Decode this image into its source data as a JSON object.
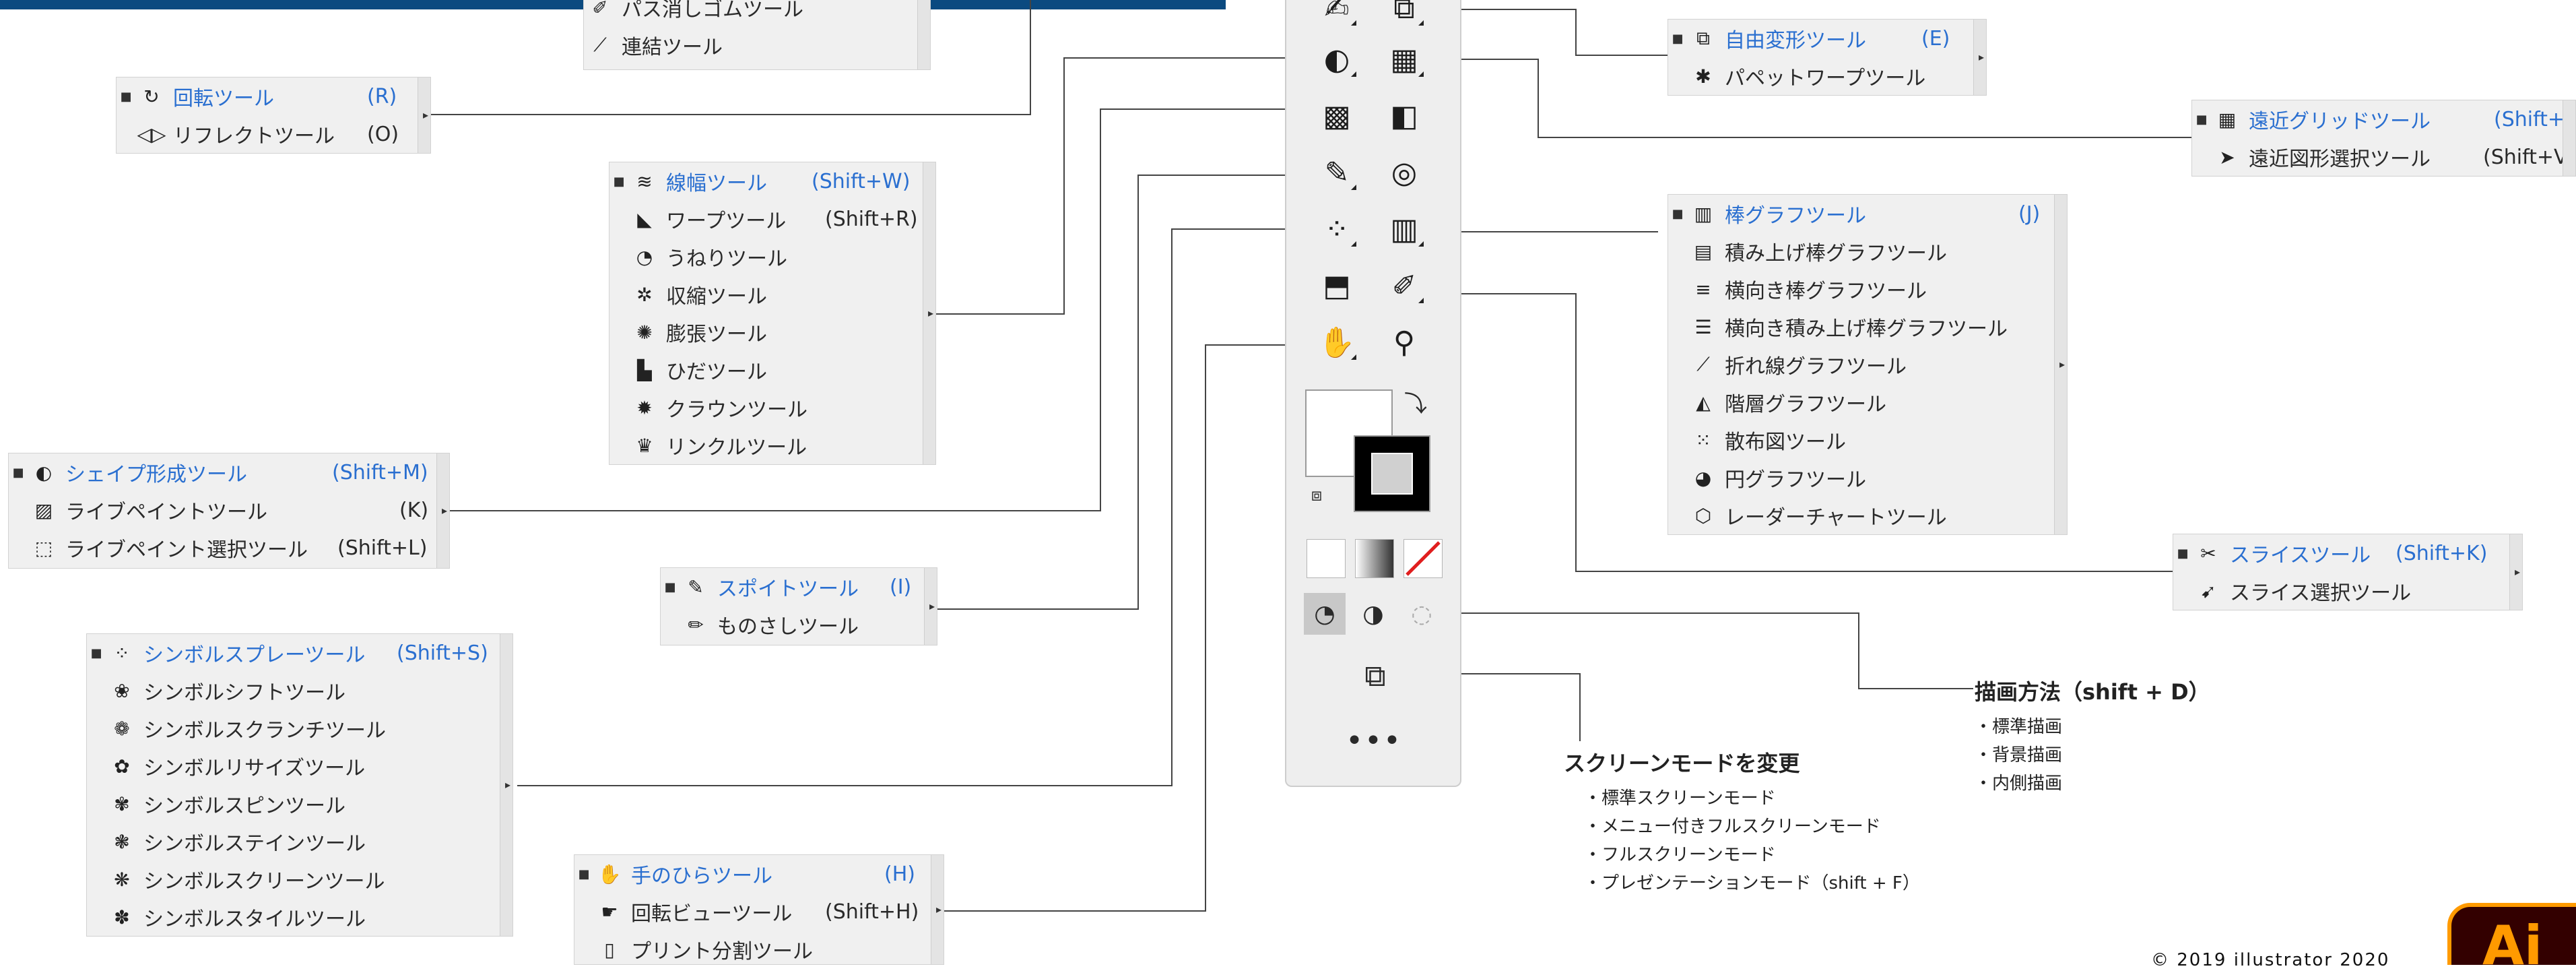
{
  "accent_color": "#2a6fd0",
  "panels": {
    "eraser": {
      "tools": [
        {
          "icon": "path-eraser-icon",
          "name": "パス消しゴムツール",
          "key": ""
        },
        {
          "icon": "join-icon",
          "name": "連結ツール",
          "key": ""
        }
      ]
    },
    "rotate": {
      "tools": [
        {
          "icon": "rotate-icon",
          "name": "回転ツール",
          "key": "(R)"
        },
        {
          "icon": "reflect-icon",
          "name": "リフレクトツール",
          "key": "(O)"
        }
      ]
    },
    "width": {
      "tools": [
        {
          "icon": "width-icon",
          "name": "線幅ツール",
          "key": "(Shift+W)"
        },
        {
          "icon": "warp-icon",
          "name": "ワープツール",
          "key": "(Shift+R)"
        },
        {
          "icon": "twirl-icon",
          "name": "うねりツール",
          "key": ""
        },
        {
          "icon": "pucker-icon",
          "name": "収縮ツール",
          "key": ""
        },
        {
          "icon": "bloat-icon",
          "name": "膨張ツール",
          "key": ""
        },
        {
          "icon": "scallop-icon",
          "name": "ひだツール",
          "key": ""
        },
        {
          "icon": "crystallize-icon",
          "name": "クラウンツール",
          "key": ""
        },
        {
          "icon": "wrinkle-icon",
          "name": "リンクルツール",
          "key": ""
        }
      ]
    },
    "shape_builder": {
      "tools": [
        {
          "icon": "shape-builder-icon",
          "name": "シェイプ形成ツール",
          "key": "(Shift+M)"
        },
        {
          "icon": "live-paint-icon",
          "name": "ライブペイントツール",
          "key": "(K)"
        },
        {
          "icon": "live-paint-select-icon",
          "name": "ライブペイント選択ツール",
          "key": "(Shift+L)"
        }
      ]
    },
    "eyedropper": {
      "tools": [
        {
          "icon": "eyedropper-icon",
          "name": "スポイトツール",
          "key": "(I)"
        },
        {
          "icon": "measure-icon",
          "name": "ものさしツール",
          "key": ""
        }
      ]
    },
    "symbol": {
      "tools": [
        {
          "icon": "symbol-sprayer-icon",
          "name": "シンボルスプレーツール",
          "key": "(Shift+S)"
        },
        {
          "icon": "symbol-shifter-icon",
          "name": "シンボルシフトツール",
          "key": ""
        },
        {
          "icon": "symbol-scruncher-icon",
          "name": "シンボルスクランチツール",
          "key": ""
        },
        {
          "icon": "symbol-sizer-icon",
          "name": "シンボルリサイズツール",
          "key": ""
        },
        {
          "icon": "symbol-spinner-icon",
          "name": "シンボルスピンツール",
          "key": ""
        },
        {
          "icon": "symbol-stainer-icon",
          "name": "シンボルステインツール",
          "key": ""
        },
        {
          "icon": "symbol-screener-icon",
          "name": "シンボルスクリーンツール",
          "key": ""
        },
        {
          "icon": "symbol-styler-icon",
          "name": "シンボルスタイルツール",
          "key": ""
        }
      ]
    },
    "hand": {
      "tools": [
        {
          "icon": "hand-icon",
          "name": "手のひらツール",
          "key": "(H)"
        },
        {
          "icon": "rotate-view-icon",
          "name": "回転ビューツール",
          "key": "(Shift+H)"
        },
        {
          "icon": "print-tiling-icon",
          "name": "プリント分割ツール",
          "key": ""
        }
      ]
    },
    "free_transform": {
      "tools": [
        {
          "icon": "free-transform-icon",
          "name": "自由変形ツール",
          "key": "(E)"
        },
        {
          "icon": "puppet-warp-icon",
          "name": "パペットワープツール",
          "key": ""
        }
      ]
    },
    "perspective": {
      "tools": [
        {
          "icon": "perspective-grid-icon",
          "name": "遠近グリッドツール",
          "key": "(Shift+P)"
        },
        {
          "icon": "perspective-select-icon",
          "name": "遠近図形選択ツール",
          "key": "(Shift+V)"
        }
      ]
    },
    "graph": {
      "tools": [
        {
          "icon": "column-graph-icon",
          "name": "棒グラフツール",
          "key": "(J)"
        },
        {
          "icon": "stacked-column-icon",
          "name": "積み上げ棒グラフツール",
          "key": ""
        },
        {
          "icon": "bar-graph-icon",
          "name": "横向き棒グラフツール",
          "key": ""
        },
        {
          "icon": "stacked-bar-icon",
          "name": "横向き積み上げ棒グラフツール",
          "key": ""
        },
        {
          "icon": "line-graph-icon",
          "name": "折れ線グラフツール",
          "key": ""
        },
        {
          "icon": "area-graph-icon",
          "name": "階層グラフツール",
          "key": ""
        },
        {
          "icon": "scatter-graph-icon",
          "name": "散布図ツール",
          "key": ""
        },
        {
          "icon": "pie-graph-icon",
          "name": "円グラフツール",
          "key": ""
        },
        {
          "icon": "radar-graph-icon",
          "name": "レーダーチャートツール",
          "key": ""
        }
      ]
    },
    "slice": {
      "tools": [
        {
          "icon": "slice-icon",
          "name": "スライスツール",
          "key": "(Shift+K)"
        },
        {
          "icon": "slice-select-icon",
          "name": "スライス選択ツール",
          "key": ""
        }
      ]
    }
  },
  "notes": {
    "draw_mode": {
      "title": "描画方法（shift + D）",
      "items": [
        "・標準描画",
        "・背景描画",
        "・内側描画"
      ]
    },
    "screen_mode": {
      "title": "スクリーンモードを変更",
      "items": [
        "・標準スクリーンモード",
        "・メニュー付きフルスクリーンモード",
        "・フルスクリーンモード",
        "・プレゼンテーションモード（shift + F）"
      ]
    }
  },
  "toolbar": {
    "more_label": "•••"
  },
  "logo": {
    "text": "Ai"
  },
  "footer": {
    "copyright": "© 2019 illustrator 2020"
  }
}
